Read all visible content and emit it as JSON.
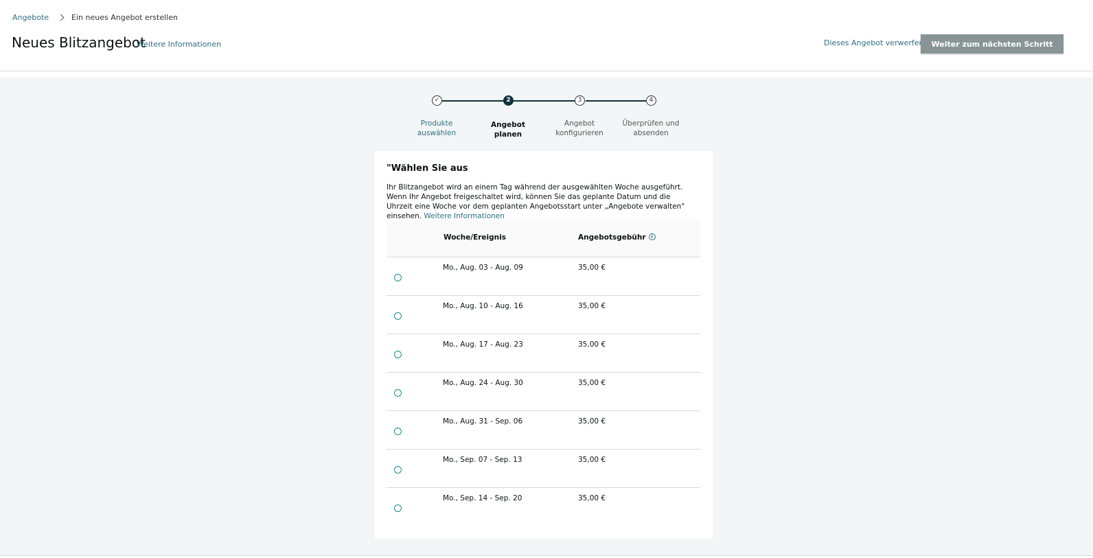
{
  "breadcrumb": {
    "parent": "Angebote",
    "current": "Ein neues Angebot erstellen"
  },
  "header": {
    "title": "Neues Blitzangebot",
    "more_info": "Weitere Informationen",
    "discard": "Dieses Angebot verwerfen",
    "next": "Weiter zum nächsten Schritt"
  },
  "stepper": {
    "steps": [
      {
        "marker": "✓",
        "label_1": "Produkte",
        "label_2": "auswählen",
        "state": "done"
      },
      {
        "marker": "2",
        "label_1": "Angebot",
        "label_2": "planen",
        "state": "active"
      },
      {
        "marker": "3",
        "label_1": "Angebot",
        "label_2": "konfigurieren",
        "state": "upcoming"
      },
      {
        "marker": "4",
        "label_1": "Überprüfen und",
        "label_2": "absenden",
        "state": "upcoming"
      }
    ]
  },
  "card": {
    "title": "\"Wählen Sie aus",
    "description": "Ihr Blitzangebot wird an einem Tag während der ausgewählten Woche ausgeführt. Wenn Ihr Angebot freigeschaltet wird, können Sie das geplante Datum und die Uhrzeit eine Woche vor dem geplanten Angebotsstart unter „Angebote verwalten\" einsehen.",
    "more_info": "Weitere Informationen"
  },
  "table": {
    "col_week": "Woche/Ereignis",
    "col_fee": "Angebotsgebühr",
    "info_icon": "i",
    "rows": [
      {
        "week": "Mo., Aug. 03 - Aug. 09",
        "fee": "35,00 €"
      },
      {
        "week": "Mo., Aug. 10 - Aug. 16",
        "fee": "35,00 €"
      },
      {
        "week": "Mo., Aug. 17 - Aug. 23",
        "fee": "35,00 €"
      },
      {
        "week": "Mo., Aug. 24 - Aug. 30",
        "fee": "35,00 €"
      },
      {
        "week": "Mo., Aug. 31 - Sep. 06",
        "fee": "35,00 €"
      },
      {
        "week": "Mo., Sep. 07 - Sep. 13",
        "fee": "35,00 €"
      },
      {
        "week": "Mo., Sep. 14 - Sep. 20",
        "fee": "35,00 €"
      }
    ]
  },
  "colors": {
    "link": "#2f6f80",
    "accent": "#1c8a8a",
    "button": "#879596",
    "background": "#f3f6f6"
  }
}
